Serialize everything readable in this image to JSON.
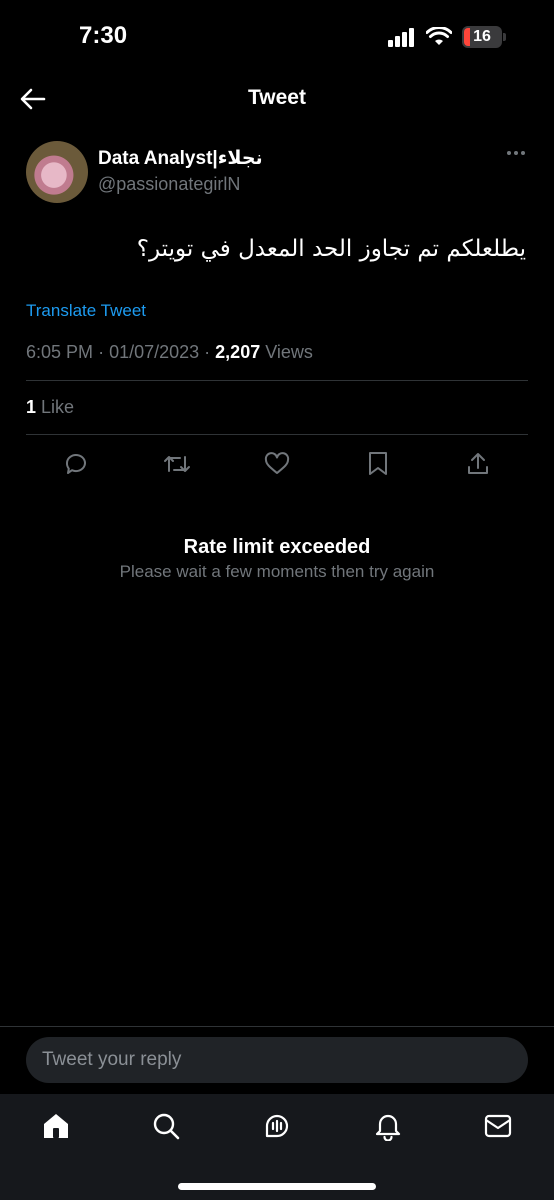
{
  "status_bar": {
    "time": "7:30",
    "battery": "16",
    "icons": [
      "signal-icon",
      "wifi-icon",
      "battery-icon"
    ]
  },
  "header": {
    "title": "Tweet",
    "back_icon": "back-arrow-icon"
  },
  "tweet": {
    "author_name": "Data Analyst|نجلاء",
    "author_handle": "@passionategirlN",
    "text": "يطلعلكم تم تجاوز الحد المعدل في تويتر؟",
    "translate_label": "Translate Tweet",
    "time": "6:05 PM",
    "date": "01/07/2023",
    "views_count": "2,207",
    "views_label": "Views",
    "likes_count": "1",
    "likes_label": "Like"
  },
  "actions": [
    "reply-icon",
    "retweet-icon",
    "like-icon",
    "bookmark-icon",
    "share-icon"
  ],
  "message": {
    "title": "Rate limit exceeded",
    "subtitle": "Please wait a few moments then try again"
  },
  "reply": {
    "placeholder": "Tweet your reply"
  },
  "tabbar": [
    "home-icon",
    "search-icon",
    "spaces-icon",
    "notifications-icon",
    "messages-icon"
  ],
  "colors": {
    "background": "#000000",
    "accent": "#1d9bf0",
    "muted": "#71767b",
    "battery_low": "#ff453a"
  }
}
